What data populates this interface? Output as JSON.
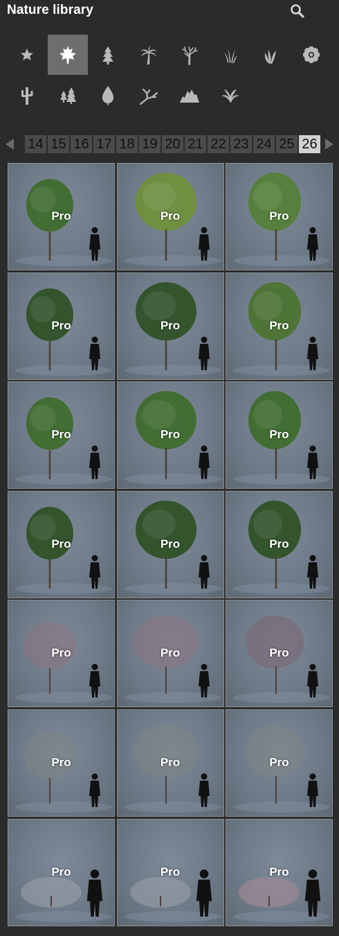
{
  "header": {
    "title": "Nature library",
    "search_icon": "search-icon"
  },
  "categories": [
    {
      "icon": "star-icon",
      "selected": false
    },
    {
      "icon": "maple-leaf-icon",
      "selected": true
    },
    {
      "icon": "conifer-icon",
      "selected": false
    },
    {
      "icon": "palm-tree-icon",
      "selected": false
    },
    {
      "icon": "bare-tree-icon",
      "selected": false
    },
    {
      "icon": "grass-icon",
      "selected": false
    },
    {
      "icon": "plant-icon",
      "selected": false
    },
    {
      "icon": "flower-icon",
      "selected": false
    },
    {
      "icon": "cactus-icon",
      "selected": false
    },
    {
      "icon": "forest-icon",
      "selected": false
    },
    {
      "icon": "leaf-icon",
      "selected": false
    },
    {
      "icon": "branch-icon",
      "selected": false
    },
    {
      "icon": "rocks-icon",
      "selected": false
    },
    {
      "icon": "fern-icon",
      "selected": false
    }
  ],
  "pager": {
    "pages": [
      "14",
      "15",
      "16",
      "17",
      "18",
      "19",
      "20",
      "21",
      "22",
      "23",
      "24",
      "25",
      "26"
    ],
    "current": "26"
  },
  "badge_label": "Pro",
  "tiles": [
    {
      "badge": "Pro",
      "foliage": "#3f6b2e",
      "kind": "green"
    },
    {
      "badge": "Pro",
      "foliage": "#6f8f3d",
      "kind": "green"
    },
    {
      "badge": "Pro",
      "foliage": "#55803a",
      "kind": "green"
    },
    {
      "badge": "Pro",
      "foliage": "#2f5127",
      "kind": "green"
    },
    {
      "badge": "Pro",
      "foliage": "#2f5127",
      "kind": "green"
    },
    {
      "badge": "Pro",
      "foliage": "#4c7333",
      "kind": "green"
    },
    {
      "badge": "Pro",
      "foliage": "#3f6b2e",
      "kind": "green"
    },
    {
      "badge": "Pro",
      "foliage": "#3f6b2e",
      "kind": "green"
    },
    {
      "badge": "Pro",
      "foliage": "#3f6b2e",
      "kind": "green"
    },
    {
      "badge": "Pro",
      "foliage": "#2f5127",
      "kind": "green"
    },
    {
      "badge": "Pro",
      "foliage": "#2f5127",
      "kind": "green"
    },
    {
      "badge": "Pro",
      "foliage": "#2f5127",
      "kind": "green"
    },
    {
      "badge": "Pro",
      "foliage": "#8a7280",
      "kind": "blossom"
    },
    {
      "badge": "Pro",
      "foliage": "#8a7280",
      "kind": "blossom"
    },
    {
      "badge": "Pro",
      "foliage": "#7a6270",
      "kind": "blossom"
    },
    {
      "badge": "Pro",
      "foliage": "#7c8584",
      "kind": "blossom"
    },
    {
      "badge": "Pro",
      "foliage": "#7c8584",
      "kind": "blossom"
    },
    {
      "badge": "Pro",
      "foliage": "#7c8584",
      "kind": "blossom"
    },
    {
      "badge": "Pro",
      "foliage": "#9aa0a6",
      "kind": "shrub"
    },
    {
      "badge": "Pro",
      "foliage": "#9aa0a6",
      "kind": "shrub"
    },
    {
      "badge": "Pro",
      "foliage": "#a58a96",
      "kind": "shrub"
    }
  ]
}
